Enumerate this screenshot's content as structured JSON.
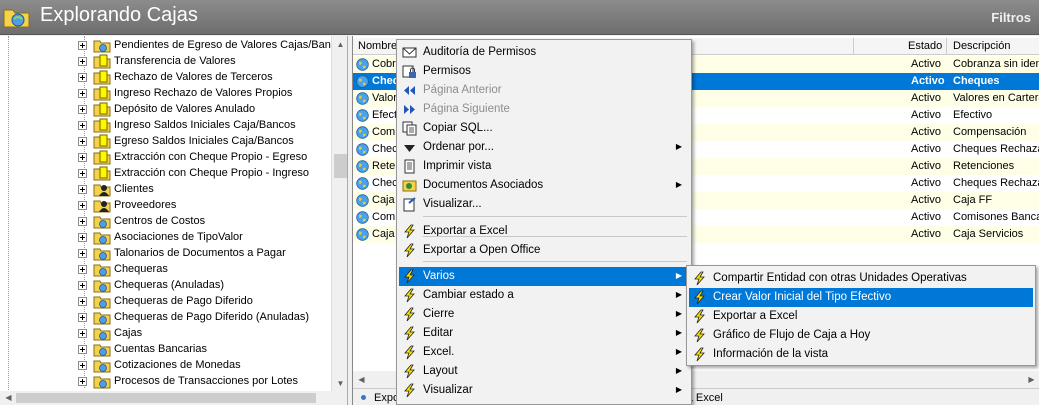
{
  "window": {
    "title": "Explorando Cajas",
    "filter_label": "Filtros"
  },
  "tree": {
    "items": [
      {
        "label": "Pendientes de Egreso de Valores Cajas/Bancos",
        "icon": "folder-icon"
      },
      {
        "label": "Transferencia de Valores",
        "icon": "document-icon"
      },
      {
        "label": "Rechazo de Valores de Terceros",
        "icon": "document-icon"
      },
      {
        "label": "Ingreso Rechazo de Valores Propios",
        "icon": "document-icon"
      },
      {
        "label": "Depósito de Valores Anulado",
        "icon": "document-icon"
      },
      {
        "label": "Ingreso Saldos Iniciales Caja/Bancos",
        "icon": "document-icon"
      },
      {
        "label": "Egreso Saldos Iniciales Caja/Bancos",
        "icon": "document-icon"
      },
      {
        "label": "Extracción con Cheque Propio - Egreso",
        "icon": "document-icon"
      },
      {
        "label": "Extracción con Cheque Propio - Ingreso",
        "icon": "document-icon"
      },
      {
        "label": "Clientes",
        "icon": "person-icon"
      },
      {
        "label": "Proveedores",
        "icon": "person-icon"
      },
      {
        "label": "Centros de Costos",
        "icon": "folder-icon"
      },
      {
        "label": "Asociaciones de TipoValor",
        "icon": "folder-icon"
      },
      {
        "label": "Talonarios de Documentos a Pagar",
        "icon": "folder-icon"
      },
      {
        "label": "Chequeras",
        "icon": "folder-icon"
      },
      {
        "label": "Chequeras (Anuladas)",
        "icon": "folder-icon"
      },
      {
        "label": "Chequeras de Pago Diferido",
        "icon": "folder-icon"
      },
      {
        "label": "Chequeras de Pago Diferido (Anuladas)",
        "icon": "folder-icon"
      },
      {
        "label": "Cajas",
        "icon": "folder-icon"
      },
      {
        "label": "Cuentas Bancarias",
        "icon": "folder-icon"
      },
      {
        "label": "Cotizaciones de Monedas",
        "icon": "folder-icon"
      },
      {
        "label": "Procesos de Transacciones por Lotes",
        "icon": "folder-icon"
      }
    ]
  },
  "grid": {
    "columns": {
      "name": "Nombre",
      "state": "Estado",
      "desc": "Descripción"
    },
    "rows": [
      {
        "name": "Cobra",
        "state": "Activo",
        "desc": "Cobranza sin identi"
      },
      {
        "name": "Cheq",
        "state": "Activo",
        "desc": "Cheques"
      },
      {
        "name": "Valor",
        "state": "Activo",
        "desc": "Valores en Cartera"
      },
      {
        "name": "Efect",
        "state": "Activo",
        "desc": "Efectivo"
      },
      {
        "name": "Comp",
        "state": "Activo",
        "desc": "Compensación"
      },
      {
        "name": "Chec",
        "state": "Activo",
        "desc": "Cheques Rechazad"
      },
      {
        "name": "Rete",
        "state": "Activo",
        "desc": "Retenciones"
      },
      {
        "name": "Chec",
        "state": "Activo",
        "desc": "Cheques Rechazad"
      },
      {
        "name": "Caja",
        "state": "Activo",
        "desc": "Caja FF"
      },
      {
        "name": "Comi",
        "state": "Activo",
        "desc": "Comisones Banca"
      },
      {
        "name": "Caja",
        "state": "Activo",
        "desc": "Caja Servicios"
      }
    ],
    "status_left": "Expo",
    "status_right": "r a Excel"
  },
  "context_menu": {
    "items": [
      {
        "label": "Auditoría de Permisos",
        "icon": "envelope-icon",
        "enabled": true,
        "submenu": false
      },
      {
        "label": "Permisos",
        "icon": "lock-icon",
        "enabled": true,
        "submenu": false
      },
      {
        "label": "Página Anterior",
        "icon": "previous-icon",
        "enabled": false,
        "submenu": false
      },
      {
        "label": "Página Siguiente",
        "icon": "next-icon",
        "enabled": false,
        "submenu": false
      },
      {
        "label": "Copiar SQL...",
        "icon": "copy-icon",
        "enabled": true,
        "submenu": false
      },
      {
        "label": "Ordenar por...",
        "icon": "sort-icon",
        "enabled": true,
        "submenu": true
      },
      {
        "label": "Imprimir vista",
        "icon": "print-icon",
        "enabled": true,
        "submenu": false
      },
      {
        "label": "Documentos Asociados",
        "icon": "documents-icon",
        "enabled": true,
        "submenu": true
      },
      {
        "label": "Visualizar...",
        "icon": "view-icon",
        "enabled": true,
        "submenu": false
      },
      {
        "label": "Exportar a Excel",
        "icon": "lightning-icon",
        "enabled": true,
        "submenu": false
      },
      {
        "label": "Exportar a Open Office",
        "icon": "lightning-icon",
        "enabled": true,
        "submenu": false
      },
      {
        "label": "Varios",
        "icon": "lightning-icon",
        "enabled": true,
        "submenu": true
      },
      {
        "label": "Cambiar estado a",
        "icon": "lightning-icon",
        "enabled": true,
        "submenu": true
      },
      {
        "label": "Cierre",
        "icon": "lightning-icon",
        "enabled": true,
        "submenu": true
      },
      {
        "label": "Editar",
        "icon": "lightning-icon",
        "enabled": true,
        "submenu": true
      },
      {
        "label": "Excel.",
        "icon": "lightning-icon",
        "enabled": true,
        "submenu": true
      },
      {
        "label": "Layout",
        "icon": "lightning-icon",
        "enabled": true,
        "submenu": true
      },
      {
        "label": "Visualizar",
        "icon": "lightning-icon",
        "enabled": true,
        "submenu": true
      }
    ]
  },
  "submenu_varios": {
    "items": [
      {
        "label": "Compartir Entidad con otras Unidades Operativas",
        "icon": "lightning-icon"
      },
      {
        "label": "Crear Valor Inicial del Tipo Efectivo",
        "icon": "lightning-icon"
      },
      {
        "label": "Exportar a Excel",
        "icon": "lightning-icon"
      },
      {
        "label": "Gráfico de Flujo de Caja a Hoy",
        "icon": "lightning-icon"
      },
      {
        "label": "Información de la vista",
        "icon": "lightning-icon"
      }
    ]
  },
  "colors": {
    "selection": "#0078d7",
    "title_bar": "#7d7d7d",
    "row_alt": "#ffffe8"
  }
}
